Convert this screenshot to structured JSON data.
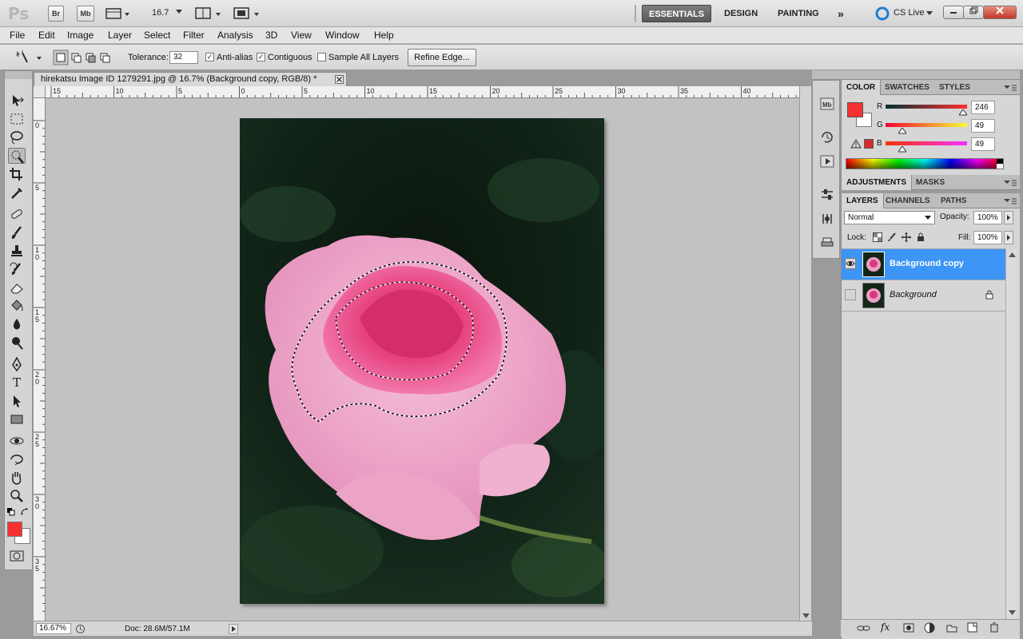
{
  "appbar": {
    "logo": "Ps",
    "bridge_label": "Br",
    "minibridge_label": "Mb",
    "zoom_value": "16.7",
    "workspaces": [
      "ESSENTIALS",
      "DESIGN",
      "PAINTING"
    ],
    "overflow": "»",
    "cslive_label": "CS Live"
  },
  "menu": [
    "File",
    "Edit",
    "Image",
    "Layer",
    "Select",
    "Filter",
    "Analysis",
    "3D",
    "View",
    "Window",
    "Help"
  ],
  "options": {
    "tolerance_label": "Tolerance:",
    "tolerance_value": "32",
    "antialias_label": "Anti-alias",
    "contiguous_label": "Contiguous",
    "sample_all_label": "Sample All Layers",
    "refine_edge_label": "Refine Edge...",
    "antialias_checked": true,
    "contiguous_checked": true,
    "sample_all_checked": false
  },
  "document": {
    "tab_title": "hirekatsu Image ID 1279291.jpg @ 16.7% (Background copy, RGB/8) *",
    "ruler_top": [
      "15",
      "10",
      "5",
      "0",
      "5",
      "10",
      "15",
      "20",
      "25",
      "30",
      "35",
      "40"
    ],
    "ruler_left": [
      "0",
      "5",
      "1\n0",
      "1\n5",
      "2\n0",
      "2\n5",
      "3\n0",
      "3\n5"
    ]
  },
  "status": {
    "zoom": "16.67%",
    "doc_size": "Doc: 28.6M/57.1M"
  },
  "color_panel": {
    "tabs": [
      "COLOR",
      "SWATCHES",
      "STYLES"
    ],
    "r_label": "R",
    "g_label": "G",
    "b_label": "B",
    "r_value": "246",
    "g_value": "49",
    "b_value": "49",
    "foreground": "#f63131",
    "background": "#ffffff"
  },
  "adjust_panel": {
    "tabs": [
      "ADJUSTMENTS",
      "MASKS"
    ]
  },
  "layers_panel": {
    "tabs": [
      "LAYERS",
      "CHANNELS",
      "PATHS"
    ],
    "blend_mode": "Normal",
    "opacity_label": "Opacity:",
    "opacity_value": "100%",
    "lock_label": "Lock:",
    "fill_label": "Fill:",
    "fill_value": "100%",
    "layers": [
      {
        "name": "Background copy",
        "selected": true,
        "visible": true
      },
      {
        "name": "Background",
        "selected": false,
        "visible": false
      }
    ]
  },
  "colors": {
    "selection_blue": "#3d95f5",
    "foreground_swatch": "#f63131"
  }
}
